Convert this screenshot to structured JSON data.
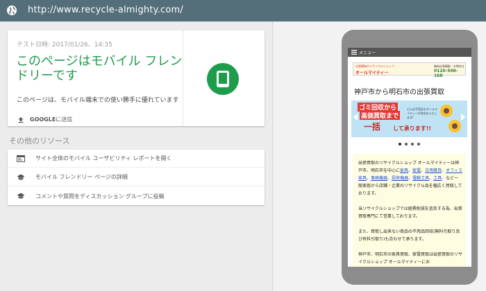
{
  "browser": {
    "url": "http://www.recycle-almighty.com/",
    "globe_icon": "globe-icon"
  },
  "result_card": {
    "timestamp": "テスト日時: 2017/01/26、14:35",
    "headline": "このページはモバイル フレンドリーです",
    "description": "このページは、モバイル端末での使い勝手に優れています",
    "submit_bold": "GOOGLE",
    "submit_rest": "に送信",
    "accent_color": "#1e9c4c"
  },
  "resources": {
    "title": "その他のリソース",
    "items": [
      {
        "icon": "report-icon",
        "label": "サイト全体のモバイル ユーザビリティ レポートを開く"
      },
      {
        "icon": "school-icon",
        "label": "モバイル フレンドリー ページの詳細"
      },
      {
        "icon": "school-icon",
        "label": "コメントや質問をディスカッション グループに投稿"
      }
    ]
  },
  "phone_preview": {
    "menu_label": "メニュー",
    "banner": {
      "tagline": "出張買取のリサイクルショップ",
      "logo": "オールマイティー",
      "tel_label": "無料出張買取・お問合せ",
      "tel_number": "0120-598-168"
    },
    "title": "神戸市から明石市の出張買取",
    "hero": {
      "line1": "ゴミ回収から",
      "line2": "高価買取まで",
      "line3": "一括",
      "line4": "して承ります!!",
      "note": "どんな不用品もオールマイティーが対応をいたします!"
    },
    "slides": 4,
    "active_slide": 1,
    "body": {
      "p1_a": "出張買取のリサイクルショップ オールマイティーは神戸市、明石市を中心に",
      "link1": "家具",
      "sep1": "、",
      "link2": "家電",
      "sep2": "、",
      "link3": "日用雑貨",
      "sep3": "、",
      "link4": "オフィス家具",
      "sep4": "、",
      "link5": "事務機器",
      "sep5": "、",
      "link6": "厨房機器",
      "sep6": "、",
      "link7": "電動工具",
      "sep7": "、",
      "link8": "工具",
      "p1_b": "、など一般家庭から店舗・企業のリサイクル品を幅広く買取しております。",
      "p2": "当リサイクルショップでは経費削減を追及する為、出張買取専門にて営業しております。",
      "p3": "また、買取し出来ない商品の不用品回収(無料引取り及び有料引取り)も合わせて承ります。",
      "p4": "神戸市、明石市の家具買取、家電買取は出張買取のリサイクルショップ オールマイティーにお"
    }
  }
}
